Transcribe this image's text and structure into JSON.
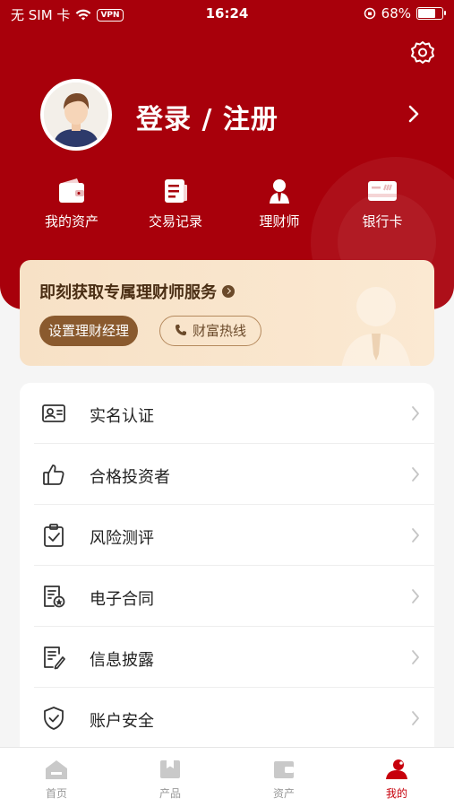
{
  "status_bar": {
    "carrier": "无 SIM 卡",
    "vpn": "VPN",
    "time": "16:24",
    "battery": "68%",
    "battery_level": 0.68
  },
  "profile": {
    "login_text": "登录 / 注册"
  },
  "quick_actions": [
    {
      "label": "我的资产",
      "icon": "wallet-icon"
    },
    {
      "label": "交易记录",
      "icon": "document-icon"
    },
    {
      "label": "理财师",
      "icon": "advisor-icon"
    },
    {
      "label": "银行卡",
      "icon": "bank-card-icon"
    }
  ],
  "advisor_card": {
    "title": "即刻获取专属理财师服务",
    "set_advisor_label": "设置理财经理",
    "hotline_label": "财富热线"
  },
  "menu": [
    {
      "label": "实名认证",
      "icon": "id-card-icon"
    },
    {
      "label": "合格投资者",
      "icon": "thumbs-up-icon"
    },
    {
      "label": "风险测评",
      "icon": "clipboard-check-icon"
    },
    {
      "label": "电子合同",
      "icon": "contract-icon"
    },
    {
      "label": "信息披露",
      "icon": "disclosure-icon"
    },
    {
      "label": "账户安全",
      "icon": "shield-check-icon"
    }
  ],
  "tabs": [
    {
      "label": "首页",
      "icon": "home-icon",
      "active": false
    },
    {
      "label": "产品",
      "icon": "product-icon",
      "active": false
    },
    {
      "label": "资产",
      "icon": "assets-icon",
      "active": false
    },
    {
      "label": "我的",
      "icon": "profile-icon",
      "active": true
    }
  ],
  "colors": {
    "brand_red": "#a8000b",
    "active_tab": "#c7000b",
    "advisor_button": "#8a5a2e"
  }
}
